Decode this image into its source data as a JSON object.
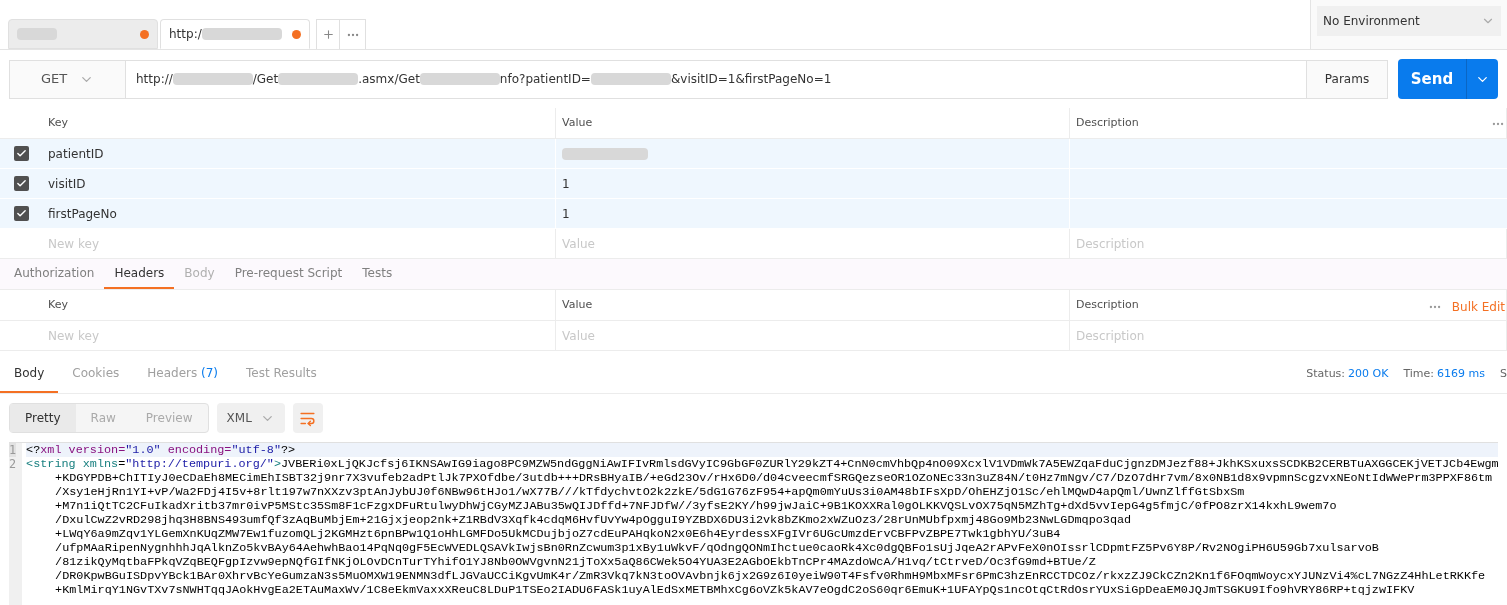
{
  "tabs": [
    {
      "kind": "redacted",
      "unsaved": true,
      "selected": false
    },
    {
      "kind": "partial",
      "label": "http:/",
      "unsaved": true,
      "selected": true
    }
  ],
  "environment": {
    "value": "No Environment"
  },
  "request": {
    "method": "GET",
    "url_parts": [
      {
        "kind": "text",
        "text": "http://"
      },
      {
        "kind": "redacted"
      },
      {
        "kind": "text",
        "text": "/Get"
      },
      {
        "kind": "redacted"
      },
      {
        "kind": "text",
        "text": ".asmx/Get"
      },
      {
        "kind": "redacted"
      },
      {
        "kind": "text",
        "text": "nfo?patientID="
      },
      {
        "kind": "redacted"
      },
      {
        "kind": "text",
        "text": "&visitID=1&firstPageNo=1"
      }
    ],
    "params_button": "Params",
    "send_button": "Send"
  },
  "params": {
    "columns": [
      "Key",
      "Value",
      "Description"
    ],
    "rows": [
      {
        "key": "patientID",
        "value": null,
        "checked": true
      },
      {
        "key": "visitID",
        "value": "1",
        "checked": true
      },
      {
        "key": "firstPageNo",
        "value": "1",
        "checked": true
      }
    ],
    "new_row": {
      "key_placeholder": "New key",
      "value_placeholder": "Value",
      "description_placeholder": "Description"
    }
  },
  "request_tabs": [
    {
      "label": "Authorization",
      "selected": false,
      "disabled": false
    },
    {
      "label": "Headers",
      "selected": true,
      "disabled": false
    },
    {
      "label": "Body",
      "selected": false,
      "disabled": true
    },
    {
      "label": "Pre-request Script",
      "selected": false,
      "disabled": false
    },
    {
      "label": "Tests",
      "selected": false,
      "disabled": false
    }
  ],
  "headers": {
    "columns": [
      "Key",
      "Value",
      "Description"
    ],
    "bulk_edit": "Bulk Edit",
    "new_row": {
      "key_placeholder": "New key",
      "value_placeholder": "Value",
      "description_placeholder": "Description"
    }
  },
  "response_tabs": [
    {
      "label": "Body",
      "selected": true
    },
    {
      "label": "Cookies",
      "selected": false
    },
    {
      "label": "Headers",
      "count": "(7)",
      "selected": false
    },
    {
      "label": "Test Results",
      "selected": false
    }
  ],
  "status": {
    "status_label": "Status:",
    "status_value": "200 OK",
    "time_label": "Time:",
    "time_value": "6169 ms",
    "size_label": "S"
  },
  "view_modes": [
    {
      "label": "Pretty",
      "selected": true
    },
    {
      "label": "Raw",
      "selected": false
    },
    {
      "label": "Preview",
      "selected": false
    }
  ],
  "format": "XML",
  "code": {
    "line_numbers": [
      "1",
      "2"
    ],
    "decl": {
      "open": "<?",
      "tag": "xml",
      "a1": "version=",
      "v1": "\"1.0\"",
      "a2": "encoding=",
      "v2": "\"utf-8\"",
      "close": "?>"
    },
    "string_tag": {
      "open": "<string",
      "attr": "xmlns",
      "eq": "=",
      "value": "\"http://tempuri.org/\"",
      "close": ">"
    },
    "first_text": "JVBERi0xLjQKJcfsj6IKNSAwIG9iago8PC9MZW5ndGggNiAwIFIvRmlsdGVyIC9GbGF0ZURlY29kZT4+CnN0cmVhbQp4nO09XcxlV1VDmWk7A5EWZqaFduCjgnzDMJezf88+JkhKSxuxsSCDKB2CERBTuAXGGCEKjVETJCb4Ewgm",
    "wrapped": [
      "+KDGYPDB+ChITIyJ0eCDaEh8MECimEhISBT32j9nr7X3vufeb2adPtlJk7PXOfdbe/3utdb+++DRsBHyaIB/+eGd23Ov/rHx6D0/d04cveecmfSRGQezseOR1OZoNEc33n3uZ84N/t0Hz7mNgv/C7/DzO7dHr7vm/8x0NB1d8x9vpmnScgzvxNEoNtIdWWePrm3PPXF86tm",
      "/Xsy1eHjRn1YI+vP/Wa2FDj4I5v+8rlt197w7nXXzv3ptAnJybUJ0f6NBw96tHJo1/wX77B///kTfdychvtO2k2zkE/5dG1G76zF954+apQm0mYuUs3i0AM48bIFsXpD/OhEHZjO1Sc/ehlMQwD4apQml/UwnZlffGtSbxSm",
      "+M7n1iQtTC2CFuIkadXritb37mr0ivP5MStc35Sm8F1cFzgxDFuRtulwyDhWjCGyMZJABu35wQIJDffd+7NFJDfW//3yfsE2KY/h99jwJaiC+9B1KOXXRal0gOLKKVQSLvOX75qN5MZhTg+dXd5vvIepG4g5fmjC/0fPO8zrX14kxhL9wem7o",
      "/DxulCwZ2vRD298jhq3H8BNS493umfQf3zAqBuMbjEm+21Gjxjeop2nk+Z1RBdV3Xqfk4cdqM6HvfUvYw4pOgguI9YZBDX6DU3i2vk8bZKmo2xWZuOz3/28rUnMUbfpxmj48Go9Mb23NwLGDmqpo3qad",
      "+LWqY6a9mZqv1YLGemXnKUqZMW7Ew1fuzomQLj2KGMHzt6pnBPw1Q1oHhLGMFDo5UkMCDujbjoZ7cdEuPAHqkoN2x0E6h4EyrdessXFgIVr6UGcUmzdErvCBFPvZBPE7Twk1gbhYU/3uB4",
      "/ufpMAaRipenNygnhhhJqAlknZo5kvBAy64AehwhBao14PqNq0gF5EcWVEDLQSAVkIwjsBn0RnZcwum3p1xBy1uWkvF/qOdngQONmIhctue0caoRk4Xc0dgQBFo1sUjJqeA2rAPvFeX0nOIssrlCDpmtFZ5Pv6Y8P/Rv2NOgiPH6U59Gb7xulsarvoB",
      "/81zikQyMqtbaFPkqVZqBEQFgpIzvw9epNQfGIfNKjOLOvDCnTurTYhifO1YJ8Nb0OWVgvnN21jToXx5aQ86CWek5O4YUA3E2AGbOEkbTnCPr4MAzdoWcA/H1vq/tCtrveD/Oc3fG9md+BTUe/Z",
      "/DR0KpwBGuISDpvYBck1BAr0XhrvBcYeGumzaN3s5MuOMXW19ENMN3dfLJGVaUCCiKgvUmK4r/ZmR3Vkq7kN3toOVAvbnjk6jx2G9z6I0yeiW90T4Fsfv0RhmH9MbxMFsr6PmC3hzEnRCCTDCOz/rkxzZJ9CkCZn2Kn1f6FOqmWoycxYJUNzVi4%cL7NGzZ4HhLetRKKfe",
      "+KmlMirqY1NGvTXv7sNWHTqqJAokHvgEa2ETAuMaxWv/1C8eEkmVaxxXReuC8LDuP1TSEo2IADU6FASk1uyAlEdSxMETBMhxCg6oVZk5kAV7eOgdC2oS60qr6EmuK+1UFAYpQs1ncOtqCtRdOsrYUxSiGpDeaEM0JQJmTSGKU9Ifo9hVRY86RP+tqjzwIFKV"
    ]
  }
}
